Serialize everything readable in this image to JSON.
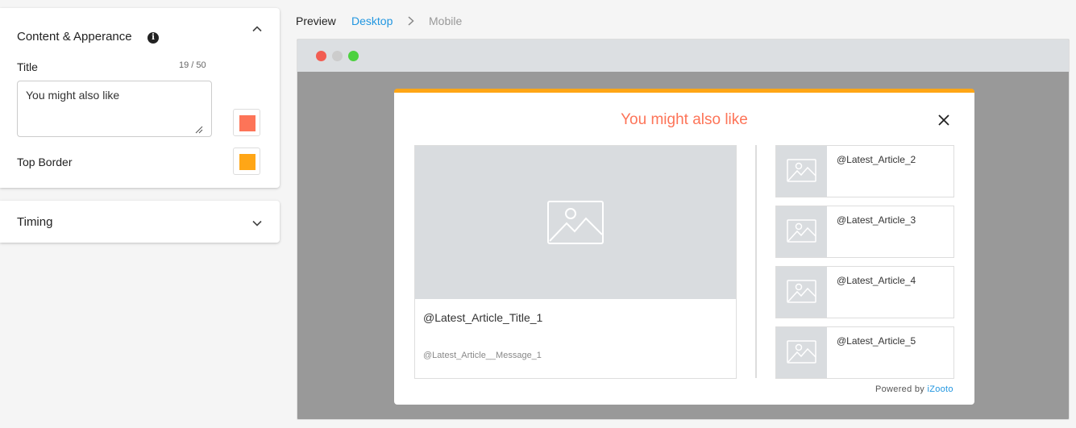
{
  "content_panel": {
    "heading": "Content & Apperance",
    "title_label": "Title",
    "title_counter": "19 / 50",
    "title_value": "You might also like",
    "top_border_label": "Top Border",
    "title_color": "#fd7458",
    "top_border_color": "#ffa616"
  },
  "timing_panel": {
    "heading": "Timing"
  },
  "breadcrumb": {
    "preview": "Preview",
    "desktop": "Desktop",
    "mobile": "Mobile"
  },
  "browser_dots": [
    "#f25d52",
    "#cccccc",
    "#4cd13f"
  ],
  "widget": {
    "title": "You might also like",
    "title_color": "#fd7458",
    "border_color": "#ffa616",
    "main_article": {
      "title": "@Latest_Article_Title_1",
      "message": "@Latest_Article__Message_1"
    },
    "side_articles": [
      "@Latest_Article_2",
      "@Latest_Article_3",
      "@Latest_Article_4",
      "@Latest_Article_5"
    ],
    "powered_prefix": "Powered by",
    "powered_brand": "iZooto"
  }
}
